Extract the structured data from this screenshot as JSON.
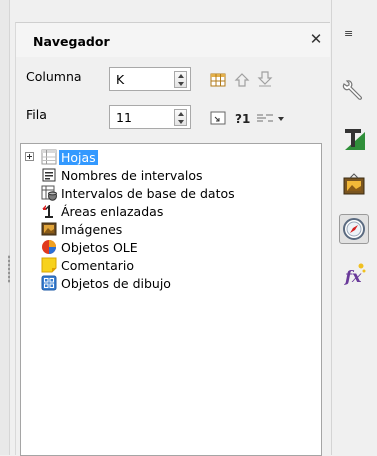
{
  "panel": {
    "title": "Navegador",
    "close_glyph": "✕"
  },
  "fields": {
    "column": {
      "label": "Columna",
      "value": "K"
    },
    "row": {
      "label": "Fila",
      "value": "11"
    }
  },
  "tree": {
    "items": [
      {
        "label": "Hojas",
        "icon": "sheets-icon",
        "selected": true,
        "expandable": true
      },
      {
        "label": "Nombres de intervalos",
        "icon": "range-names-icon"
      },
      {
        "label": "Intervalos de base de datos",
        "icon": "database-ranges-icon"
      },
      {
        "label": "Áreas enlazadas",
        "icon": "linked-areas-icon"
      },
      {
        "label": "Imágenes",
        "icon": "images-icon"
      },
      {
        "label": "Objetos OLE",
        "icon": "ole-objects-icon"
      },
      {
        "label": "Comentario",
        "icon": "comment-icon"
      },
      {
        "label": "Objetos de dibujo",
        "icon": "drawing-objects-icon"
      }
    ]
  },
  "sidebar": {
    "menu_glyph": "≡",
    "buttons": [
      "properties-icon",
      "styles-icon",
      "gallery-icon",
      "navigator-icon",
      "functions-icon"
    ]
  },
  "colors": {
    "selection": "#3399ff",
    "navigator_active": "#e2e2e2"
  }
}
